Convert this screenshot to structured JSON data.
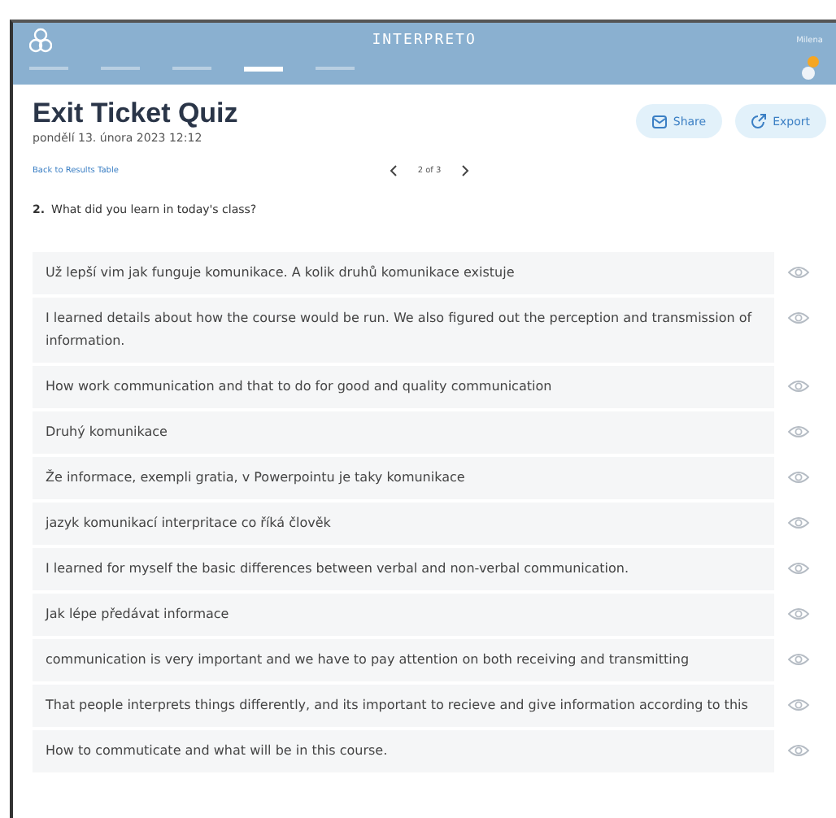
{
  "header": {
    "title": "INTERPRETO",
    "user": "Milena",
    "nav_tabs": [
      {
        "selected": false
      },
      {
        "selected": false
      },
      {
        "selected": false
      },
      {
        "selected": true
      },
      {
        "selected": false
      }
    ]
  },
  "quiz": {
    "title": "Exit Ticket Quiz",
    "date": "pondělí 13. února 2023 12:12",
    "actions": [
      "Share",
      "Export"
    ]
  },
  "navigation": {
    "back": "Back to Results Table",
    "pager": "2 of 3"
  },
  "question": {
    "number": "2.",
    "text": "What did you learn in today's class?"
  },
  "answers": [
    {
      "text": "Už lepší vim jak funguje komunikace. A kolik druhů komunikace existuje"
    },
    {
      "text": "I learned details about how the course would be run. We also figured out the perception and transmission of information."
    },
    {
      "text": "How work communication and that to do for good and quality communication"
    },
    {
      "text": "Druhý komunikace"
    },
    {
      "text": "Že informace, exempli gratia, v Powerpointu je taky komunikace"
    },
    {
      "text": "jazyk komunikací interpritace co říká člověk"
    },
    {
      "text": "I learned for myself the basic differences between verbal and non-verbal communication."
    },
    {
      "text": "Jak lépe předávat informace"
    },
    {
      "text": "communication is very important and we have to pay attention on both receiving and transmitting"
    },
    {
      "text": "That people interprets things differently, and its important to recieve and give information according to this"
    },
    {
      "text": "How to commuticate and what will be in this course."
    }
  ]
}
